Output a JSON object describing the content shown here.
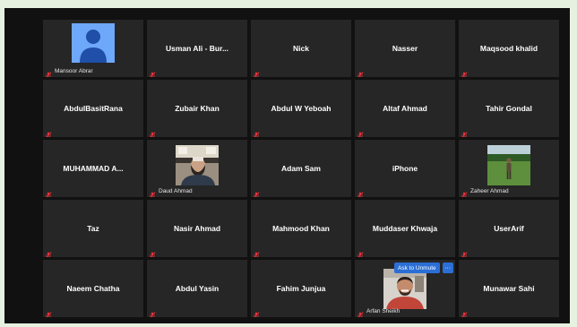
{
  "participants": [
    {
      "name": "Mansoor Abrar",
      "type": "avatar"
    },
    {
      "name": "Usman Ali - Bur..."
    },
    {
      "name": "Nick"
    },
    {
      "name": "Nasser"
    },
    {
      "name": "Maqsood khalid"
    },
    {
      "name": "AbdulBasitRana"
    },
    {
      "name": "Zubair Khan"
    },
    {
      "name": "Abdul W Yeboah"
    },
    {
      "name": "Altaf Ahmad"
    },
    {
      "name": "Tahir Gondal"
    },
    {
      "name": "MUHAMMAD A..."
    },
    {
      "name": "Daud Ahmad",
      "type": "video"
    },
    {
      "name": "Adam Sam"
    },
    {
      "name": "iPhone"
    },
    {
      "name": "Zaheer Ahmad",
      "type": "video"
    },
    {
      "name": "Taz"
    },
    {
      "name": "Nasir Ahmad"
    },
    {
      "name": "Mahmood Khan"
    },
    {
      "name": "Muddaser Khwaja"
    },
    {
      "name": "UserArif"
    },
    {
      "name": "Naeem Chatha"
    },
    {
      "name": "Abdul Yasin"
    },
    {
      "name": "Fahim  Junjua"
    },
    {
      "name": "Arfan Sheikh",
      "type": "video",
      "hover": true
    },
    {
      "name": "Munawar Sahi"
    }
  ],
  "hover_controls": {
    "unmute_label": "Ask to Unmute",
    "more_label": "···"
  },
  "colors": {
    "tile_bg": "#262626",
    "muted_icon": "#e5313a",
    "avatar_bg": "#6ea8fa",
    "accent": "#2b6fd6"
  }
}
